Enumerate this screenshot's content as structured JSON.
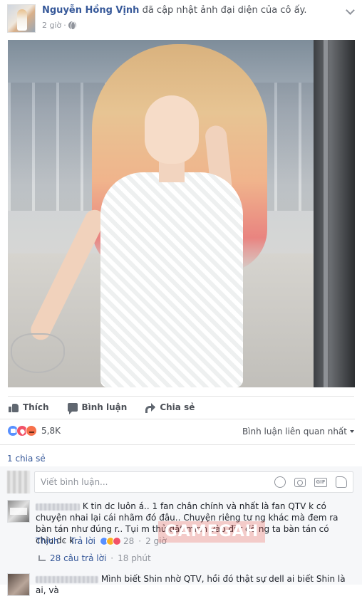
{
  "post": {
    "author": "Nguyễn Hồng Vịnh",
    "action": "đã cập nhật ảnh đại diện của cô ấy.",
    "time": "2 giờ",
    "privacy_icon": "globe-icon",
    "menu_icon": "chevron-down-icon"
  },
  "actions": {
    "like": "Thích",
    "comment": "Bình luận",
    "share": "Chia sẻ"
  },
  "reactions": {
    "types": [
      "like",
      "love",
      "angry"
    ],
    "count": "5,8K",
    "sort_label": "Bình luận liên quan nhất"
  },
  "shares": "1 chia sẻ",
  "composer": {
    "placeholder": "Viết bình luận...",
    "icons": [
      "emoji-icon",
      "camera-icon",
      "gif-icon",
      "sticker-icon"
    ],
    "gif_label": "GIF"
  },
  "comments": [
    {
      "text": "K tin dc luôn á.. 1 fan chân chính và nhất là fan QTV k có chuyện nhai lại cái nhãm đó đâu.. Chuyện riêng tư ng khác mà đem ra bàn tán như đúng r.. Tụi m thử đặt mình vào đi r đẽ ng ta bàn tán có chịu dc k..",
      "like_label": "Thích",
      "reply_label": "Trả lời",
      "reaction_count": "28",
      "time": "2 giờ",
      "replies_label": "28 câu trả lời",
      "replies_time": "18 phút"
    },
    {
      "text": "Mình biết Shin nhờ QTV, hồi đó thật sự dell ai biết Shin là ai, và"
    }
  ],
  "watermark": "GAMEGAH",
  "colors": {
    "link": "#365899",
    "text": "#1d2129",
    "muted": "#90949c",
    "like": "#5890ff",
    "love": "#f25268",
    "angry": "#f7714b"
  }
}
